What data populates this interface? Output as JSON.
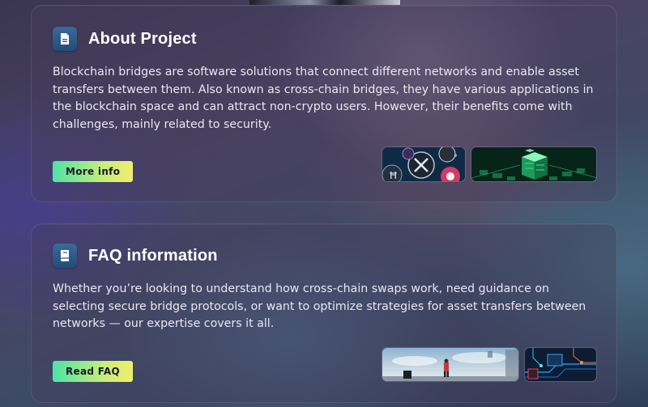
{
  "about": {
    "title": "About Project",
    "icon": "document-icon",
    "body": "Blockchain bridges are software solutions that connect different networks and enable asset transfers between them. Also known as cross-chain bridges, they have various applications in the blockchain space and can attract non-crypto users. However, their benefits come with challenges, mainly related to security.",
    "button_label": "More info"
  },
  "faq": {
    "title": "FAQ information",
    "icon": "book-icon",
    "body": "Whether you’re looking to understand how cross-chain swaps work, need guidance on selecting secure bridge protocols, or want to optimize strategies for asset transfers between networks — our expertise covers it all.",
    "button_label": "Read FAQ"
  },
  "colors": {
    "accent_start": "#4de3a6",
    "accent_end": "#f0ee6e",
    "icon_bg": "#2f5b8a"
  }
}
